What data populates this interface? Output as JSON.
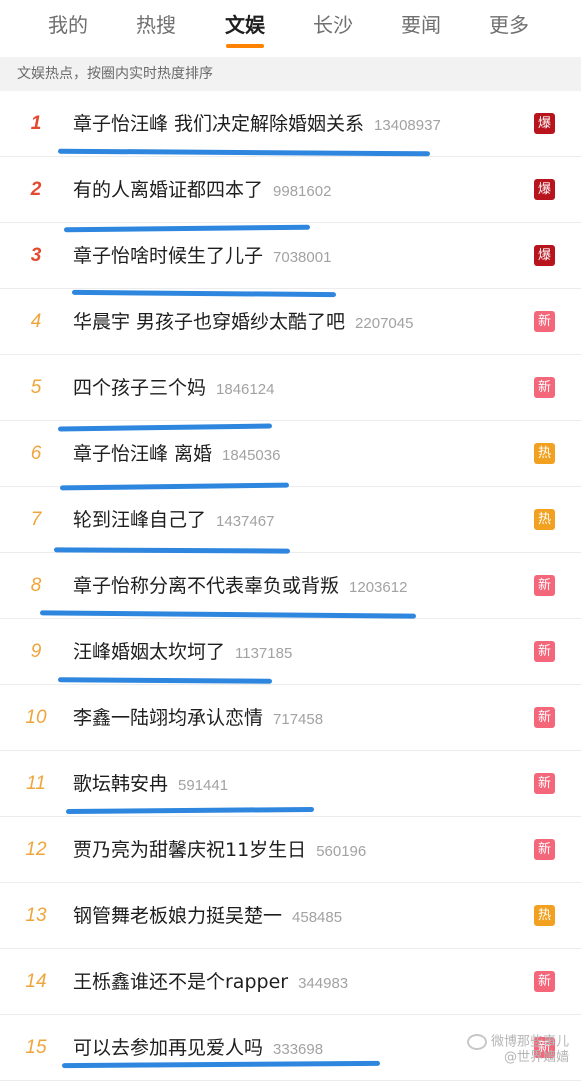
{
  "tabs": [
    {
      "label": "我的"
    },
    {
      "label": "热搜"
    },
    {
      "label": "文娱"
    },
    {
      "label": "长沙"
    },
    {
      "label": "要闻"
    },
    {
      "label": "更多"
    }
  ],
  "active_tab": "文娱",
  "subheader": "文娱热点，按圈内实时热度排序",
  "accent": "#ff8200",
  "underline_color": "#2e86de",
  "badge_colors": {
    "爆": "#b8141e",
    "新": "#f4667a",
    "热": "#f2a020"
  },
  "items": [
    {
      "rank": "1",
      "title": "章子怡汪峰 我们决定解除婚姻关系",
      "count": "13408937",
      "badge": "爆"
    },
    {
      "rank": "2",
      "title": "有的人离婚证都四本了",
      "count": "9981602",
      "badge": "爆"
    },
    {
      "rank": "3",
      "title": "章子怡啥时候生了儿子",
      "count": "7038001",
      "badge": "爆"
    },
    {
      "rank": "4",
      "title": "华晨宇 男孩子也穿婚纱太酷了吧",
      "count": "2207045",
      "badge": "新"
    },
    {
      "rank": "5",
      "title": "四个孩子三个妈",
      "count": "1846124",
      "badge": "新"
    },
    {
      "rank": "6",
      "title": "章子怡汪峰 离婚",
      "count": "1845036",
      "badge": "热"
    },
    {
      "rank": "7",
      "title": "轮到汪峰自己了",
      "count": "1437467",
      "badge": "热"
    },
    {
      "rank": "8",
      "title": "章子怡称分离不代表辜负或背叛",
      "count": "1203612",
      "badge": "新"
    },
    {
      "rank": "9",
      "title": "汪峰婚姻太坎坷了",
      "count": "1137185",
      "badge": "新"
    },
    {
      "rank": "10",
      "title": "李鑫一陆翊均承认恋情",
      "count": "717458",
      "badge": "新"
    },
    {
      "rank": "11",
      "title": "歌坛韩安冉",
      "count": "591441",
      "badge": "新"
    },
    {
      "rank": "12",
      "title": "贾乃亮为甜馨庆祝11岁生日",
      "count": "560196",
      "badge": "新"
    },
    {
      "rank": "13",
      "title": "钢管舞老板娘力挺吴楚一",
      "count": "458485",
      "badge": "热"
    },
    {
      "rank": "14",
      "title": "王栎鑫谁还不是个rapper",
      "count": "344983",
      "badge": "新"
    },
    {
      "rank": "15",
      "title": "可以去参加再见爱人吗",
      "count": "333698",
      "badge": "新"
    }
  ],
  "watermark": {
    "line1": "微博那些事儿",
    "line2": "@世界嫱嫱"
  }
}
